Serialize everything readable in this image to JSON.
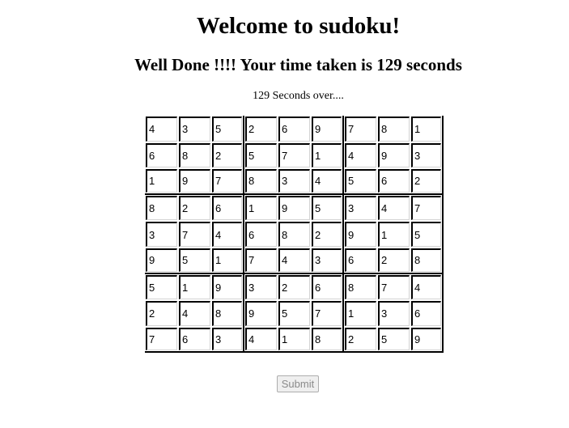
{
  "page": {
    "title": "Welcome to sudoku!",
    "result_message": "Well Done !!!! Your time taken is 129 seconds",
    "timer_text": "129 Seconds over...."
  },
  "board": [
    [
      "4",
      "3",
      "5",
      "2",
      "6",
      "9",
      "7",
      "8",
      "1"
    ],
    [
      "6",
      "8",
      "2",
      "5",
      "7",
      "1",
      "4",
      "9",
      "3"
    ],
    [
      "1",
      "9",
      "7",
      "8",
      "3",
      "4",
      "5",
      "6",
      "2"
    ],
    [
      "8",
      "2",
      "6",
      "1",
      "9",
      "5",
      "3",
      "4",
      "7"
    ],
    [
      "3",
      "7",
      "4",
      "6",
      "8",
      "2",
      "9",
      "1",
      "5"
    ],
    [
      "9",
      "5",
      "1",
      "7",
      "4",
      "3",
      "6",
      "2",
      "8"
    ],
    [
      "5",
      "1",
      "9",
      "3",
      "2",
      "6",
      "8",
      "7",
      "4"
    ],
    [
      "2",
      "4",
      "8",
      "9",
      "5",
      "7",
      "1",
      "3",
      "6"
    ],
    [
      "7",
      "6",
      "3",
      "4",
      "1",
      "8",
      "2",
      "5",
      "9"
    ]
  ],
  "actions": {
    "submit_label": "Submit",
    "submit_disabled": true
  }
}
